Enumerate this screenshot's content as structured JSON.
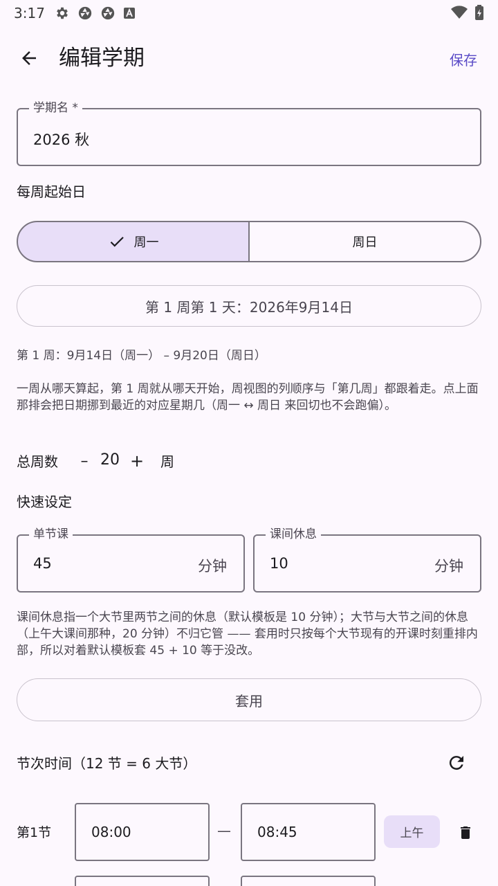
{
  "status_bar": {
    "time": "3:17",
    "left_icons": [
      "gear-icon",
      "aperture-icon",
      "aperture-icon",
      "a-box-icon"
    ],
    "right_icons": [
      "wifi-icon",
      "battery-icon"
    ]
  },
  "app_bar": {
    "title": "编辑学期",
    "save_label": "保存"
  },
  "term_name": {
    "label": "学期名 *",
    "value": "2026 秋"
  },
  "week_start": {
    "label": "每周起始日",
    "options": [
      "周一",
      "周日"
    ],
    "selected": "周一"
  },
  "first_day_button": "第 1 周第 1 天：2026年9月14日",
  "week1_range": "第 1 周：9月14日（周一） – 9月20日（周日）",
  "week_start_help": "一周从哪天算起，第 1 周就从哪天开始，周视图的列顺序与「第几周」都跟着走。点上面那排会把日期挪到最近的对应星期几（周一 ↔ 周日 来回切也不会跑偏）。",
  "total_weeks": {
    "label": "总周数",
    "minus": "–",
    "value": "20",
    "plus": "+",
    "unit": "周"
  },
  "quick_setup": {
    "label": "快速设定",
    "lesson": {
      "label": "单节课",
      "value": "45",
      "suffix": "分钟"
    },
    "break": {
      "label": "课间休息",
      "value": "10",
      "suffix": "分钟"
    },
    "help": "课间休息指一个大节里两节之间的休息（默认模板是 10 分钟）；大节与大节之间的休息（上午大课间那种，20 分钟）不归它管 —— 套用时只按每个大节现有的开课时刻重排内部，所以对着默认模板套 45 + 10 等于没改。",
    "apply_label": "套用"
  },
  "periods": {
    "header": "节次时间（12 节 = 6 大节）",
    "rows": [
      {
        "name": "第1节",
        "start": "08:00",
        "end": "08:45",
        "dash": "—",
        "chip": "上午"
      }
    ]
  },
  "colors": {
    "accent": "#5a4bc7",
    "selected_bg": "#e8def8",
    "outline": "#7a7580",
    "background": "#fdf8fe"
  }
}
